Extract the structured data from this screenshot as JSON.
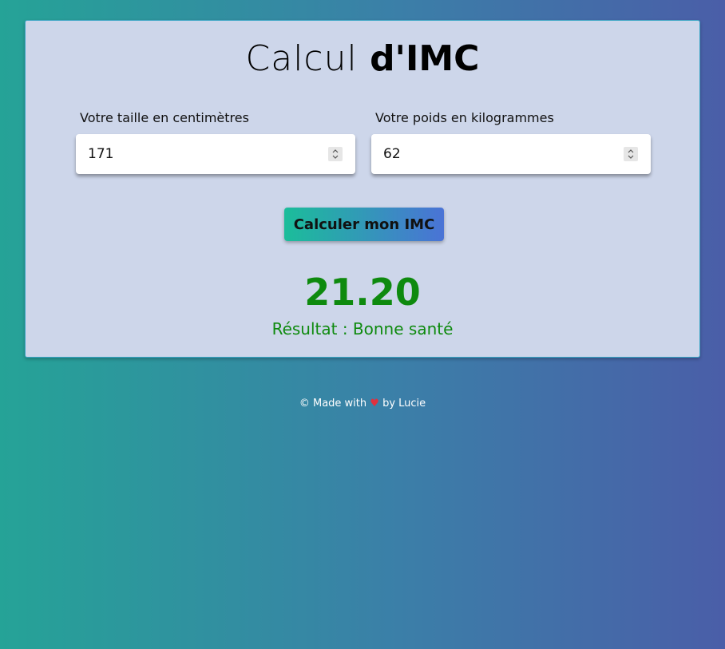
{
  "header": {
    "title_light": "Calcul",
    "title_bold": "d'IMC"
  },
  "form": {
    "height": {
      "label": "Votre taille en centimètres",
      "value": "171"
    },
    "weight": {
      "label": "Votre poids en kilogrammes",
      "value": "62"
    },
    "submit_label": "Calculer mon IMC"
  },
  "result": {
    "value": "21.20",
    "text": "Résultat : Bonne santé",
    "color": "#0e8a0e"
  },
  "footer": {
    "prefix": "© Made with",
    "heart": "♥",
    "suffix": "by Lucie"
  },
  "colors": {
    "accent_start": "#1bbd9a",
    "accent_end": "#4a73d6",
    "card_bg": "#cdd6ea"
  },
  "icons": {
    "spinner": "spinner-arrows-icon",
    "heart": "heart-icon"
  }
}
